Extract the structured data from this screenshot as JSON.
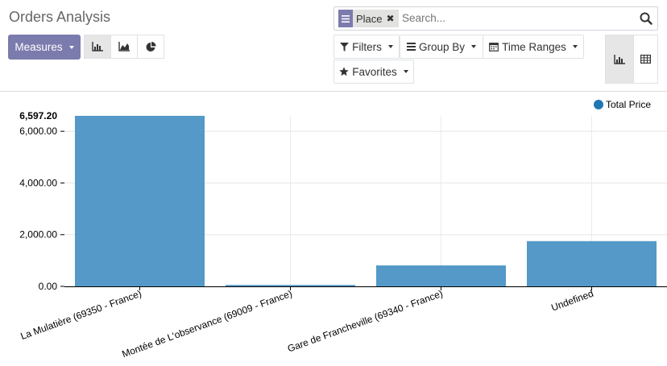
{
  "app": {
    "title": "Orders Analysis"
  },
  "toolbar": {
    "measures_label": "Measures",
    "chart_types": [
      "bar-chart-icon",
      "line-chart-icon",
      "pie-chart-icon"
    ],
    "active_chart_type": "bar"
  },
  "search": {
    "facet_label": "Place",
    "facet_icon": "list-icon",
    "placeholder": "Search..."
  },
  "filters": {
    "filters_label": "Filters",
    "group_by_label": "Group By",
    "time_ranges_label": "Time Ranges",
    "favorites_label": "Favorites"
  },
  "view_switcher": {
    "views": [
      "graph-view-icon",
      "pivot-view-icon"
    ],
    "active": "graph"
  },
  "colors": {
    "accent": "#7c7bad",
    "series": "#5499c7",
    "legend_dot": "#1f77b4"
  },
  "chart_data": {
    "type": "bar",
    "categories": [
      "La Mulatière (69350 - France)",
      "Montée de L'observance (69009 - France)",
      "Gare de Francheville (69340 - France)",
      "Undefined"
    ],
    "series": [
      {
        "name": "Total Price",
        "values": [
          6597.2,
          55,
          810,
          1750
        ]
      }
    ],
    "yticks": [
      "0.00",
      "2,000.00",
      "4,000.00",
      "6,000.00"
    ],
    "ymax_label": "6,597.20",
    "ylim": [
      0,
      6597.2
    ],
    "legend_position": "top-right",
    "grid": true
  }
}
